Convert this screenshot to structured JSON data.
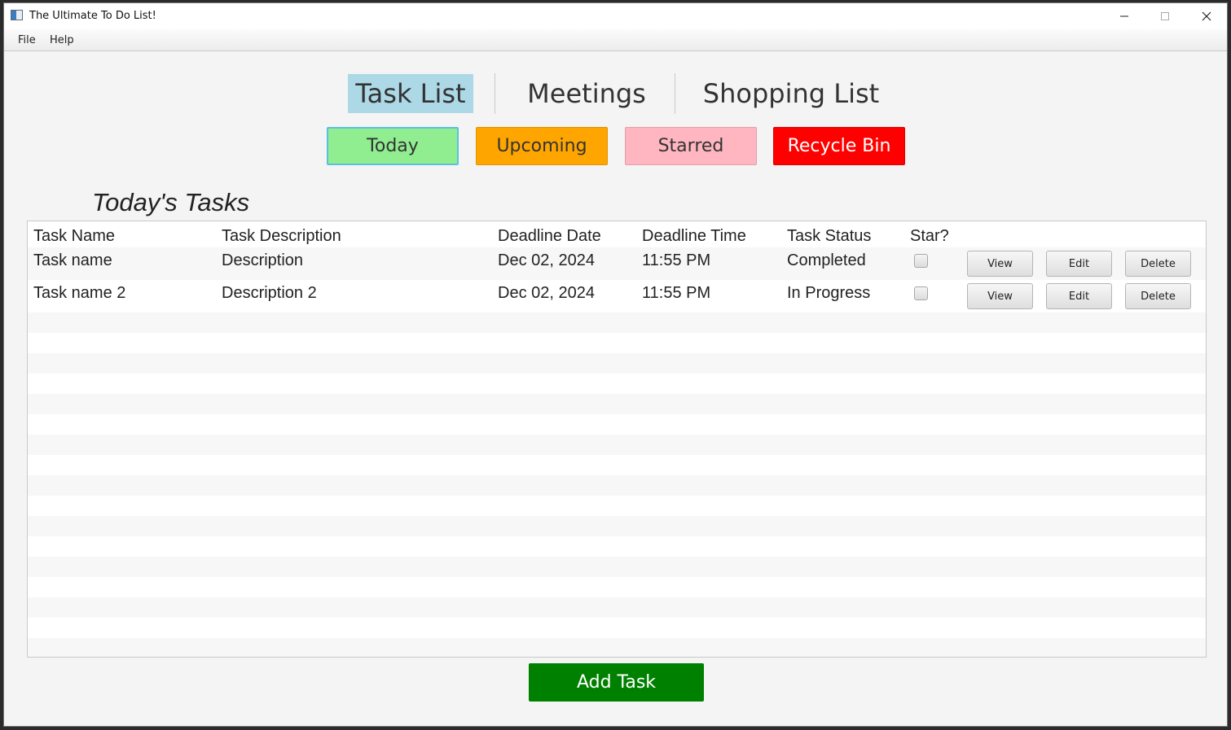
{
  "window": {
    "title": "The Ultimate To Do List!"
  },
  "menu": {
    "file": "File",
    "help": "Help"
  },
  "tabs": [
    {
      "label": "Task List",
      "active": true
    },
    {
      "label": "Meetings",
      "active": false
    },
    {
      "label": "Shopping List",
      "active": false
    }
  ],
  "filters": [
    {
      "label": "Today",
      "color": "#90ee90",
      "text_color": "#333333",
      "selected": true
    },
    {
      "label": "Upcoming",
      "color": "#ffa500",
      "text_color": "#333333",
      "selected": false
    },
    {
      "label": "Starred",
      "color": "#ffb6c1",
      "text_color": "#333333",
      "selected": false
    },
    {
      "label": "Recycle Bin",
      "color": "#ff0000",
      "text_color": "#ffffff",
      "selected": false
    }
  ],
  "section_title": "Today's Tasks",
  "table": {
    "columns": [
      "Task Name",
      "Task Description",
      "Deadline Date",
      "Deadline Time",
      "Task Status",
      "Star?"
    ],
    "rows": [
      {
        "name": "Task name",
        "description": "Description",
        "date": "Dec 02, 2024",
        "time": "11:55 PM",
        "status": "Completed",
        "starred": false,
        "view": "View",
        "edit": "Edit",
        "delete": "Delete"
      },
      {
        "name": "Task name 2",
        "description": "Description 2",
        "date": "Dec 02, 2024",
        "time": "11:55 PM",
        "status": "In Progress",
        "starred": false,
        "view": "View",
        "edit": "Edit",
        "delete": "Delete"
      }
    ]
  },
  "add_task_label": "Add Task",
  "colors": {
    "active_tab": "#add8e6",
    "add_task": "#008000"
  }
}
